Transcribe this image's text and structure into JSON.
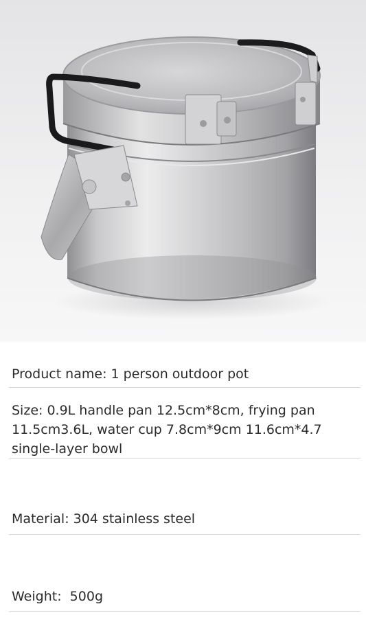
{
  "specs": {
    "product_name": "Product name: 1 person outdoor pot",
    "size": "Size: 0.9L handle pan 12.5cm*8cm, frying pan 11.5cm3.6L, water cup 7.8cm*9cm 11.6cm*4.7 single-layer bowl",
    "material": "Material: 304 stainless steel",
    "weight": "Weight:  500g"
  }
}
